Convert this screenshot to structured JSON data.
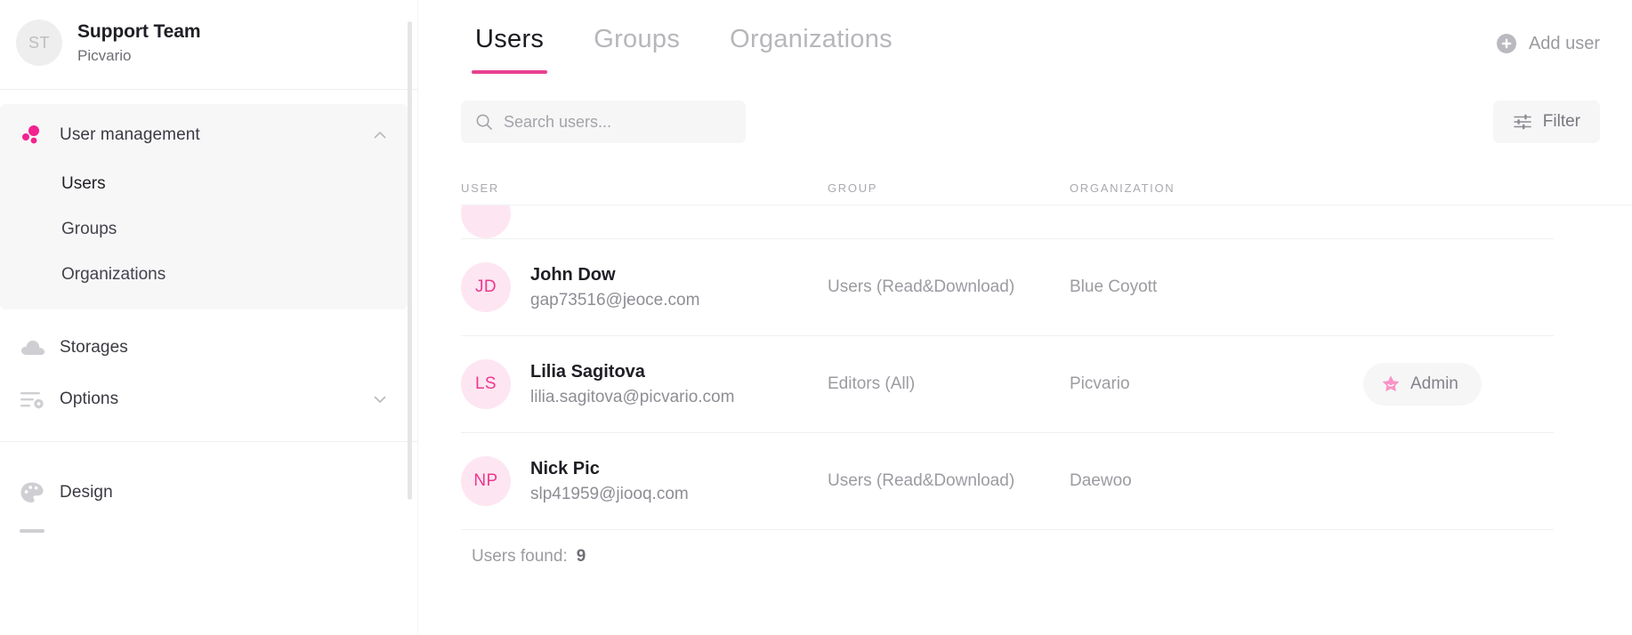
{
  "accent": "#e8418f",
  "sidebar": {
    "account": {
      "initials": "ST",
      "name": "Support Team",
      "org": "Picvario"
    },
    "user_management": {
      "label": "User management",
      "icon": "dots-cluster-icon",
      "expanded": true,
      "chevron": "chevron-up-icon",
      "children": [
        {
          "label": "Users",
          "active": true
        },
        {
          "label": "Groups",
          "active": false
        },
        {
          "label": "Organizations",
          "active": false
        }
      ]
    },
    "items": [
      {
        "label": "Storages",
        "icon": "cloud-icon",
        "chevron": ""
      },
      {
        "label": "Options",
        "icon": "settings-sliders-icon",
        "chevron": "chevron-down-icon"
      }
    ],
    "items2": [
      {
        "label": "Design",
        "icon": "palette-icon",
        "chevron": ""
      }
    ]
  },
  "main": {
    "tabs": [
      {
        "label": "Users",
        "active": true
      },
      {
        "label": "Groups",
        "active": false
      },
      {
        "label": "Organizations",
        "active": false
      }
    ],
    "add_user": {
      "label": "Add user",
      "icon": "plus-circle-icon"
    },
    "search": {
      "placeholder": "Search users...",
      "value": "",
      "icon": "search-icon"
    },
    "filter": {
      "label": "Filter",
      "icon": "sliders-icon"
    },
    "table": {
      "columns": [
        "USER",
        "GROUP",
        "ORGANIZATION"
      ],
      "rows": [
        {
          "initials": "JD",
          "name": "John Dow",
          "email": "gap73516@jeoce.com",
          "group": "Users (Read&Download)",
          "organization": "Blue Coyott",
          "badge": ""
        },
        {
          "initials": "LS",
          "name": "Lilia Sagitova",
          "email": "lilia.sagitova@picvario.com",
          "group": "Editors (All)",
          "organization": "Picvario",
          "badge": "Admin"
        },
        {
          "initials": "NP",
          "name": "Nick Pic",
          "email": "slp41959@jiooq.com",
          "group": "Users (Read&Download)",
          "organization": "Daewoo",
          "badge": ""
        }
      ]
    },
    "footer": {
      "label": "Users found:",
      "count": "9"
    }
  }
}
